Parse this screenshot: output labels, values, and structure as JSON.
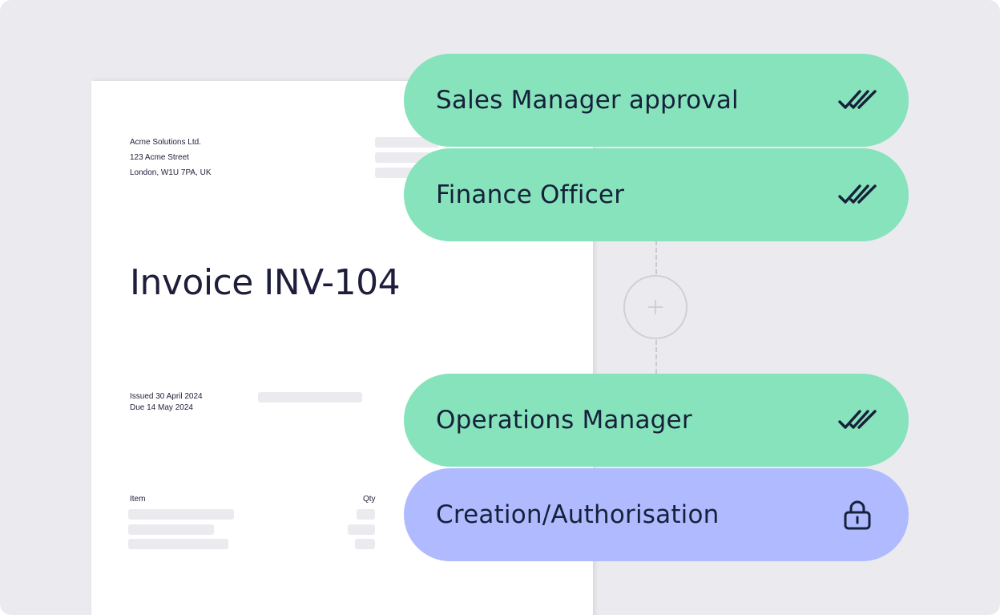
{
  "invoice": {
    "company": "Acme Solutions Ltd.",
    "street": "123 Acme Street",
    "city": "London, W1U 7PA, UK",
    "title": "Invoice INV-104",
    "issued": "Issued 30 April 2024",
    "due": "Due 14 May 2024",
    "item_header": "Item",
    "qty_header": "Qty"
  },
  "workflow": {
    "steps": [
      {
        "label": "Sales Manager approval",
        "status": "approved",
        "icon": "double-check-icon"
      },
      {
        "label": "Finance Officer",
        "status": "approved",
        "icon": "double-check-icon"
      },
      {
        "label": "Operations Manager",
        "status": "approved",
        "icon": "double-check-icon"
      },
      {
        "label": "Creation/Authorisation",
        "status": "locked",
        "icon": "lock-icon"
      }
    ],
    "add_step_icon": "plus-icon"
  },
  "colors": {
    "approved": "#86e3bb",
    "locked": "#b0bbff",
    "background": "#ebebef",
    "text": "#17203a"
  }
}
